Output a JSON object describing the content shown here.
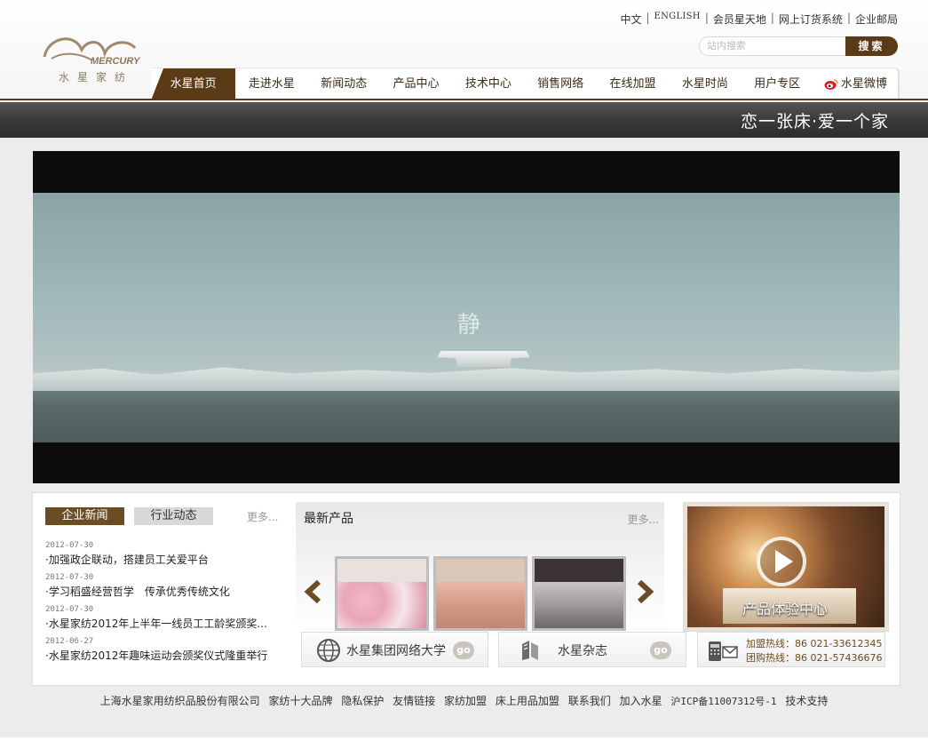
{
  "logo": {
    "brand_en": "MERCURY",
    "brand_cn": "水星家纺"
  },
  "toplinks": [
    "中文",
    "ENGLISH",
    "会员星天地",
    "网上订货系统",
    "企业邮局"
  ],
  "search": {
    "placeholder": "站内搜索",
    "button": "搜索"
  },
  "nav": [
    "水星首页",
    "走进水星",
    "新闻动态",
    "产品中心",
    "技术中心",
    "销售网络",
    "在线加盟",
    "水星时尚",
    "用户专区",
    "水星微博"
  ],
  "slogan": "恋一张床·爱一个家",
  "video": {
    "caption": "静"
  },
  "news": {
    "tab_active": "企业新闻",
    "tab_inactive": "行业动态",
    "more": "更多...",
    "items": [
      {
        "date": "2012-07-30",
        "title": "·加强政企联动，搭建员工关爱平台"
      },
      {
        "date": "2012-07-30",
        "title": "·学习稻盛经营哲学　传承优秀传统文化"
      },
      {
        "date": "2012-07-30",
        "title": "·水星家纺2012年上半年一线员工工龄奖颁奖..."
      },
      {
        "date": "2012-06-27",
        "title": "·水星家纺2012年趣味运动会颁奖仪式隆重举行"
      }
    ]
  },
  "products": {
    "title": "最新产品",
    "more": "更多..."
  },
  "experience": {
    "label": "产品体验中心"
  },
  "links": {
    "university": "水星集团网络大学",
    "magazine": "水星杂志",
    "go": "go"
  },
  "hotline": {
    "franchise": "加盟热线：86 021-33612345",
    "group": "团购热线：86 021-57436676"
  },
  "footer": [
    "上海水星家用纺织品股份有限公司",
    "家纺十大品牌",
    "隐私保护",
    "友情链接",
    "家纺加盟",
    "床上用品加盟",
    "联系我们",
    "加入水星",
    "沪ICP备11007312号-1",
    "技术支持"
  ],
  "colors": {
    "brand": "#5b3b16",
    "banner": "#3a3a3a"
  }
}
